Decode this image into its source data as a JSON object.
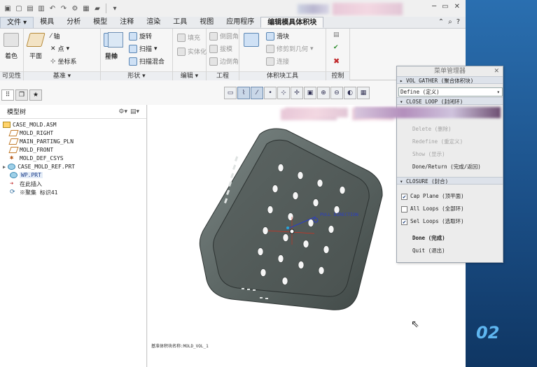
{
  "quick_access": {
    "icons": [
      "new-icon",
      "open-icon",
      "save-icon",
      "undo-icon",
      "redo-icon",
      "regenerate-icon",
      "windows-icon",
      "folder-icon"
    ]
  },
  "menu_tabs": [
    "文件",
    "模具",
    "分析",
    "模型",
    "注释",
    "渲染",
    "工具",
    "视图",
    "应用程序",
    "编辑模具体积块"
  ],
  "ribbon": {
    "visibility": {
      "button": "着色",
      "label": "可见性"
    },
    "datum": {
      "plane": "平面",
      "axis": "轴",
      "point": "点",
      "csys": "坐标系",
      "label": "基准"
    },
    "shapes": {
      "sketch": "草绘",
      "extrude": "拉伸",
      "revolve": "旋转",
      "sweep": "扫描",
      "swept_blend": "扫描混合",
      "label": "形状"
    },
    "editing": {
      "fill": "填充",
      "solidify": "实体化",
      "label": "编辑"
    },
    "engineering": {
      "round": "倒圆角",
      "draft": "拔模",
      "chamfer": "边倒角",
      "label": "工程"
    },
    "volume_tools": {
      "slide": "滑块",
      "trim_to_geom": "修剪到几何",
      "join": "连接",
      "label": "体积块工具"
    },
    "controls": {
      "label": "控制"
    }
  },
  "model_tree": {
    "title": "模型树",
    "items": [
      "CASE_MOLD.ASM",
      "MOLD_RIGHT",
      "MAIN_PARTING_PLN",
      "MOLD_FRONT",
      "MOLD_DEF_CSYS",
      "CASE_MOLD_REF.PRT",
      "WP.PRT",
      "在此插入",
      "※聚集 标识41"
    ]
  },
  "viewport": {
    "direction_label": "PULL DIRECTION",
    "status_text": "基准体积块名称:MOLD_VOL_1"
  },
  "menu_manager": {
    "title": "菜单管理器",
    "vol_gather": "VOL GATHER (聚合体积块)",
    "define": "Define (定义)",
    "close_loop": "CLOSE LOOP (封闭环)",
    "delete": "Delete (删除)",
    "redefine": "Redefine (重定义)",
    "show": "Show (显示)",
    "done_return": "Done/Return (完成/返回)",
    "closure": "CLOSURE (封合)",
    "cap_plane": "Cap Plane (顶平面)",
    "all_loops": "All Loops (全部环)",
    "sel_loops": "Sel Loops (选取环)",
    "done": "Done (完成)",
    "quit": "Quit (退出)",
    "checks": {
      "cap_plane": true,
      "all_loops": false,
      "sel_loops": true
    }
  },
  "desktop": {
    "number": "02"
  }
}
